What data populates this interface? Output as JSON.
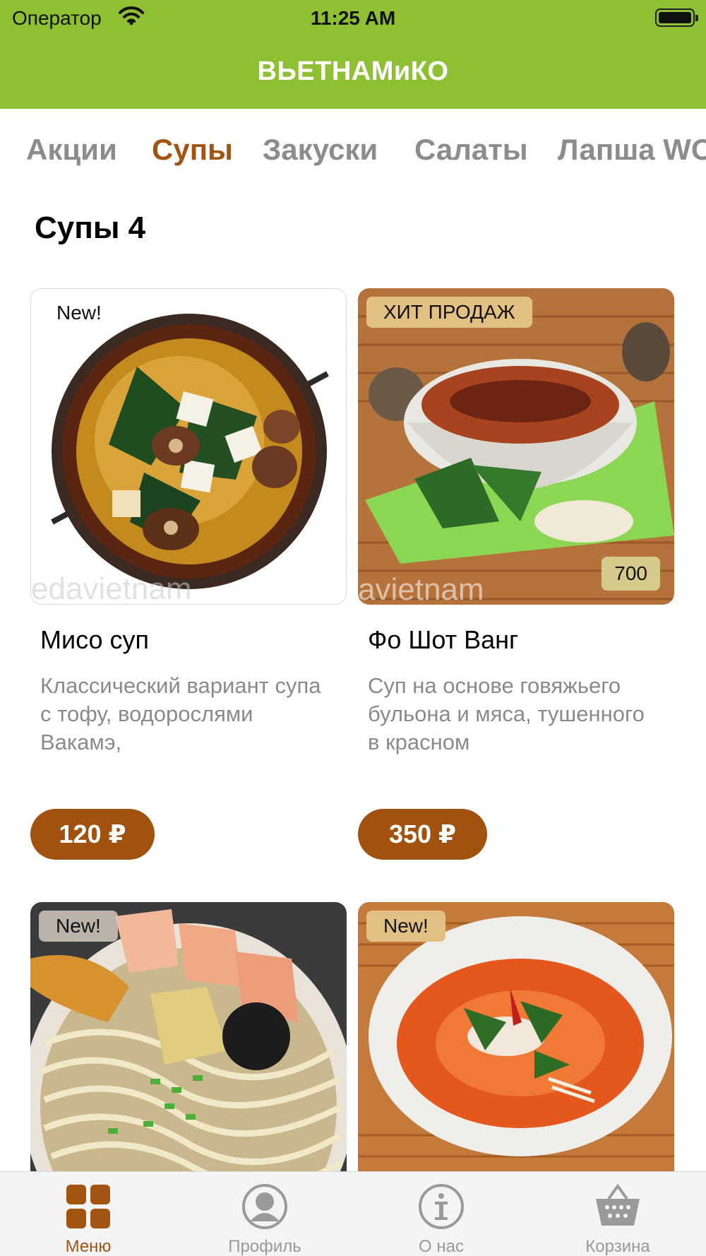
{
  "status_bar": {
    "carrier": "Оператор",
    "time": "11:25 AM"
  },
  "nav": {
    "title": "ВЬЕТНАМиКО"
  },
  "categories": [
    {
      "label": "Акции",
      "active": false
    },
    {
      "label": "Супы",
      "active": true
    },
    {
      "label": "Закуски",
      "active": false
    },
    {
      "label": "Салаты",
      "active": false
    },
    {
      "label": "Лапша WOK",
      "active": false
    }
  ],
  "section": {
    "title": "Супы 4"
  },
  "products": [
    {
      "name": "Мисо суп",
      "description": "Классический вариант супа с тофу, водорослями Вакамэ,",
      "price": "120 ₽",
      "badge": "New!",
      "watermark": "edavietnam"
    },
    {
      "name": "Фо Шот Ванг",
      "description": "Суп на основе говяжьего бульона и мяса, тушенного в красном",
      "price": "350 ₽",
      "badge": "ХИТ ПРОДАЖ",
      "quantity": "700",
      "watermark": "avietnam"
    },
    {
      "badge": "New!"
    },
    {
      "badge": "New!"
    }
  ],
  "tab_bar": {
    "items": [
      {
        "label": "Меню",
        "icon": "grid-icon",
        "active": true
      },
      {
        "label": "Профиль",
        "icon": "profile-icon",
        "active": false
      },
      {
        "label": "О нас",
        "icon": "info-icon",
        "active": false
      },
      {
        "label": "Корзина",
        "icon": "basket-icon",
        "active": false
      }
    ]
  },
  "colors": {
    "brand_green": "#8fc034",
    "accent_brown": "#a1520f",
    "inactive_grey": "#8c8c8c"
  }
}
